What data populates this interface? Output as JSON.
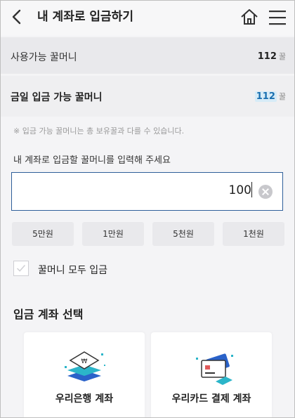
{
  "header": {
    "title": "내 계좌로 입금하기",
    "back_icon": "chevron-left-icon",
    "home_icon": "home-icon",
    "menu_icon": "hamburger-menu-icon"
  },
  "balances": {
    "available_label": "사용가능 꿀머니",
    "available_value": "112",
    "available_unit": "꿀",
    "today_label": "금일 입금 가능 꿀머니",
    "today_value": "112",
    "today_unit": "꿀"
  },
  "note": "※ 입금 가능 꿀머니는 총 보유꿀과 다를 수 있습니다.",
  "input": {
    "prompt": "내 계좌로 입금할 꿀머니를 입력해 주세요",
    "value": "100",
    "clear_icon": "clear-circle-icon"
  },
  "quick_amounts": [
    "5만원",
    "1만원",
    "5천원",
    "1천원"
  ],
  "deposit_all": {
    "label": "꿀머니 모두 입금",
    "checked": false
  },
  "account_section": {
    "title": "입금 계좌 선택",
    "options": [
      {
        "label": "우리은행 계좌",
        "icon": "bank-stack-icon"
      },
      {
        "label": "우리카드 결제 계좌",
        "icon": "credit-card-icon"
      }
    ]
  },
  "colors": {
    "accent": "#2f5f9a",
    "highlight_bg": "#d6ebf7",
    "highlight_text": "#1a6fb0",
    "bank_teal": "#2bb5c9",
    "bank_blue": "#2a62c9"
  }
}
